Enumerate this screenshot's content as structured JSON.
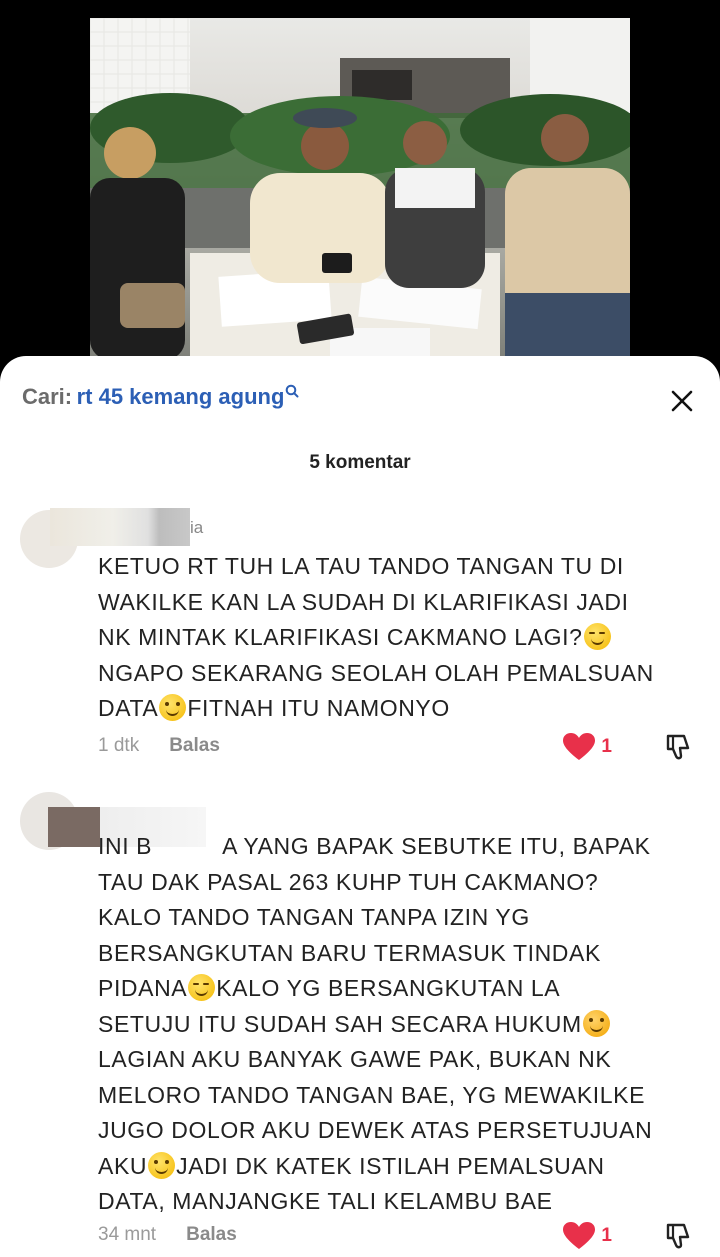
{
  "search": {
    "label": "Cari:",
    "term": "rt 45 kemang agung"
  },
  "comments_count": "5 komentar",
  "comments": [
    {
      "username_partial": "ia",
      "lines": [
        "KETUO RT TUH LA TAU TANDO TANGAN TU DI",
        "WAKILKE KAN LA SUDAH DI KLARIFIKASI JADI",
        "NK MINTAK KLARIFIKASI CAKMANO LAGI?",
        "NGAPO SEKARANG SEOLAH OLAH PEMALSUAN",
        "DATA",
        "FITNAH ITU NAMONYO"
      ],
      "time": "1 dtk",
      "reply": "Balas",
      "likes": "1"
    },
    {
      "lines": [
        "INI B",
        "A YANG BAPAK SEBUTKE ITU, BAPAK",
        "TAU DAK PASAL 263 KUHP TUH CAKMANO?",
        "KALO TANDO TANGAN TANPA IZIN YG",
        "BERSANGKUTAN BARU TERMASUK TINDAK",
        "PIDANA",
        "KALO YG BERSANGKUTAN LA",
        "SETUJU ITU SUDAH SAH SECARA HUKUM",
        "LAGIAN AKU BANYAK GAWE PAK, BUKAN NK",
        "MELORO TANDO TANGAN BAE, YG MEWAKILKE",
        "JUGO DOLOR AKU DEWEK ATAS PERSETUJUAN",
        "AKU",
        "JADI DK KATEK ISTILAH PEMALSUAN",
        "DATA, MANJANGKE TALI KELAMBU BAE"
      ],
      "time": "34 mnt",
      "reply": "Balas",
      "likes": "1"
    }
  ],
  "colors": {
    "accent_blue": "#2c5fb5",
    "like_red": "#e8304a"
  },
  "icons": [
    "search-icon",
    "close-icon",
    "heart-icon",
    "dislike-icon",
    "blushing-smile-emoji",
    "smile-emoji",
    "smiling-hearts-emoji"
  ]
}
